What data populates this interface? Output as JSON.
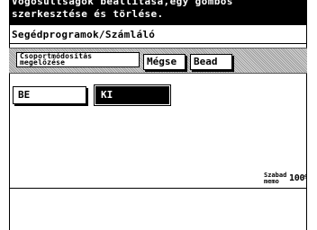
{
  "header": {
    "line1": "Vogosultságok beállítása,egy gombos",
    "line2": "szerkesztése és törlése."
  },
  "title": "Segédprogramok/Számláló",
  "toolbar": {
    "label_line1": "Csoportmódosítás",
    "label_line2": "megelőzése",
    "cancel_label": "Mégse",
    "apply_label": "Bead"
  },
  "options": [
    {
      "label": "BE",
      "selected": false
    },
    {
      "label": "KI",
      "selected": true
    }
  ],
  "memory": {
    "label_line1": "Szabad",
    "label_line2": "memo",
    "value": "100%"
  }
}
